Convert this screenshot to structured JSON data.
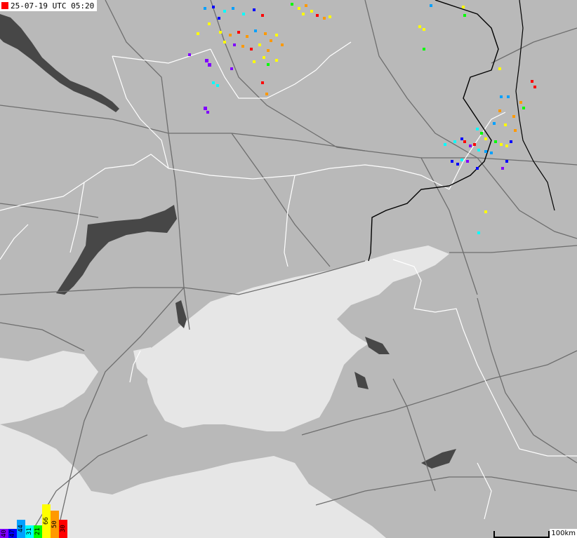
{
  "timestamp": {
    "text": "25-07-19 UTC 05:20",
    "marker_color": "#ff0000"
  },
  "scale": {
    "label": "100km"
  },
  "legend": [
    {
      "label": "40",
      "color": "#8000ff",
      "level": 0.27
    },
    {
      "label": "47",
      "color": "#0000ff",
      "level": 0.27
    },
    {
      "label": "44",
      "color": "#00a0ff",
      "level": 0.55
    },
    {
      "label": "31",
      "color": "#00ffff",
      "level": 0.37
    },
    {
      "label": "21",
      "color": "#00ff00",
      "level": 0.37
    },
    {
      "label": "66",
      "color": "#ffff00",
      "level": 1.0
    },
    {
      "label": "50",
      "color": "#ff9900",
      "level": 0.82
    },
    {
      "label": "30",
      "color": "#ff0000",
      "level": 0.55
    }
  ],
  "colors": {
    "land": "#b9b9b9",
    "sea": "#e6e6e6",
    "reservoir": "#474747",
    "roads": "#6e6e6e",
    "admin_borders": "#ffffff",
    "national_border": "#000000"
  }
}
